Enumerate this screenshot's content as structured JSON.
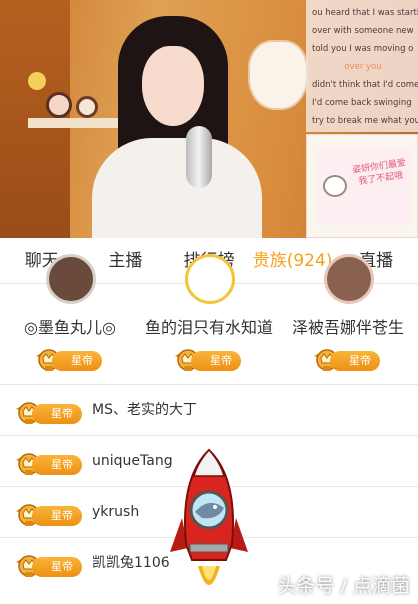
{
  "video": {
    "lyrics": [
      "ou heard that I was startin",
      "over with someone new",
      "told you I was moving o",
      "over you",
      "didn't think that I'd come",
      "I'd come back swinging",
      "try to break me what you"
    ],
    "gift_card_text": "姿妍你们最爱我了不起哦"
  },
  "tabs": [
    "聊天",
    "主播",
    "排行榜",
    "贵族(924)",
    "直播"
  ],
  "active_tab_index": 3,
  "top_fans": [
    {
      "name": "◎墨鱼丸儿◎",
      "badge": "星帝"
    },
    {
      "name": "鱼的泪只有水知道",
      "badge": "星帝"
    },
    {
      "name": "泽被吾娜伴苍生",
      "badge": "星帝"
    }
  ],
  "members": [
    {
      "name": "MS、老实的大丁",
      "badge": "星帝"
    },
    {
      "name": "uniqueTang",
      "badge": "星帝"
    },
    {
      "name": "ykrush",
      "badge": "星帝"
    },
    {
      "name": "凯凯兔1106",
      "badge": "星帝"
    }
  ],
  "watermark": "头条号 / 点滴菌",
  "colors": {
    "accent": "#f5a21b",
    "badge_gradient_top": "#f9b53a",
    "badge_gradient_bottom": "#ee8f12",
    "rocket_red": "#d8251d"
  },
  "icons": {
    "badge_emblem": "crown-wings-icon",
    "gift": "rocket-icon"
  }
}
